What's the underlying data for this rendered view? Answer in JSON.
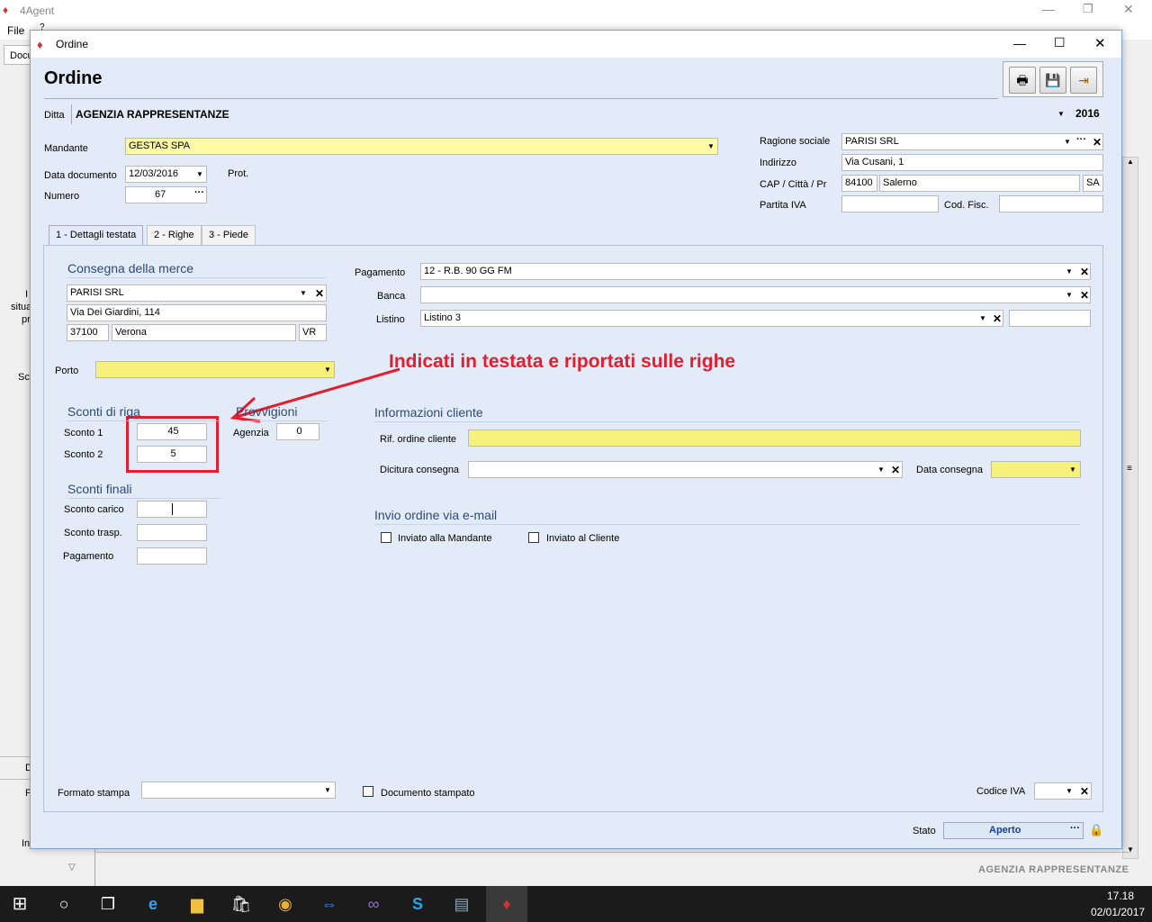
{
  "main_app": {
    "title": "4Agent",
    "menu_file": "File",
    "menu_help": "?",
    "side_tab": "Docu",
    "side_texts": [
      "I",
      "situa",
      "pr",
      "Sc",
      "D",
      "P",
      "In"
    ],
    "side_arrow": "▽",
    "footer_company": "AGENZIA RAPPRESENTANZE"
  },
  "dialog": {
    "title": "Ordine",
    "header_title": "Ordine",
    "ditta_label": "Ditta",
    "ditta_value": "AGENZIA RAPPRESENTANZE",
    "year": "2016",
    "mandante_label": "Mandante",
    "mandante_value": "GESTAS SPA",
    "data_doc_label": "Data documento",
    "data_doc_value": "12/03/2016",
    "prot_label": "Prot.",
    "numero_label": "Numero",
    "numero_value": "67",
    "ragione_label": "Ragione sociale",
    "ragione_value": "PARISI SRL",
    "indirizzo_label": "Indirizzo",
    "indirizzo_value": "Via Cusani, 1",
    "cap_label": "CAP / Città / Pr",
    "cap_value": "84100",
    "citta_value": "Salerno",
    "pr_value": "SA",
    "piva_label": "Partita IVA",
    "piva_value": "",
    "codfisc_label": "Cod. Fisc.",
    "codfisc_value": "",
    "tabs": [
      "1 - Dettagli testata",
      "2 - Righe",
      "3 - Piede"
    ],
    "consegna": {
      "title": "Consegna della merce",
      "name": "PARISI SRL",
      "address": "Via Dei Giardini, 114",
      "cap": "37100",
      "city": "Verona",
      "prov": "VR"
    },
    "pagamento_label": "Pagamento",
    "pagamento_value": "12 - R.B. 90 GG FM",
    "banca_label": "Banca",
    "banca_value": "",
    "listino_label": "Listino",
    "listino_value": "Listino 3",
    "listino_extra": "",
    "porto_label": "Porto",
    "porto_value": "",
    "annotation": "Indicati in testata e riportati sulle righe",
    "sconti_riga": {
      "title": "Sconti di riga",
      "s1_label": "Sconto 1",
      "s1_value": "45",
      "s2_label": "Sconto 2",
      "s2_value": "5"
    },
    "provvigioni": {
      "title": "Provvigioni",
      "agenzia_label": "Agenzia",
      "agenzia_value": "0"
    },
    "sconti_finali": {
      "title": "Sconti finali",
      "carico_label": "Sconto carico",
      "carico_value": "",
      "trasp_label": "Sconto trasp.",
      "trasp_value": "",
      "pag_label": "Pagamento",
      "pag_value": ""
    },
    "info_cliente": {
      "title": "Informazioni cliente",
      "rif_label": "Rif. ordine cliente",
      "rif_value": "",
      "dicitura_label": "Dicitura consegna",
      "dicitura_value": "",
      "data_label": "Data consegna",
      "data_value": ""
    },
    "email": {
      "title": "Invio ordine via e-mail",
      "mandante": "Inviato alla Mandante",
      "cliente": "Inviato al Cliente"
    },
    "formato_label": "Formato stampa",
    "formato_value": "",
    "stampato_label": "Documento stampato",
    "codiva_label": "Codice IVA",
    "codiva_value": "",
    "stato_label": "Stato",
    "stato_value": "Aperto"
  },
  "taskbar": {
    "time": "17.18",
    "date": "02/01/2017"
  }
}
